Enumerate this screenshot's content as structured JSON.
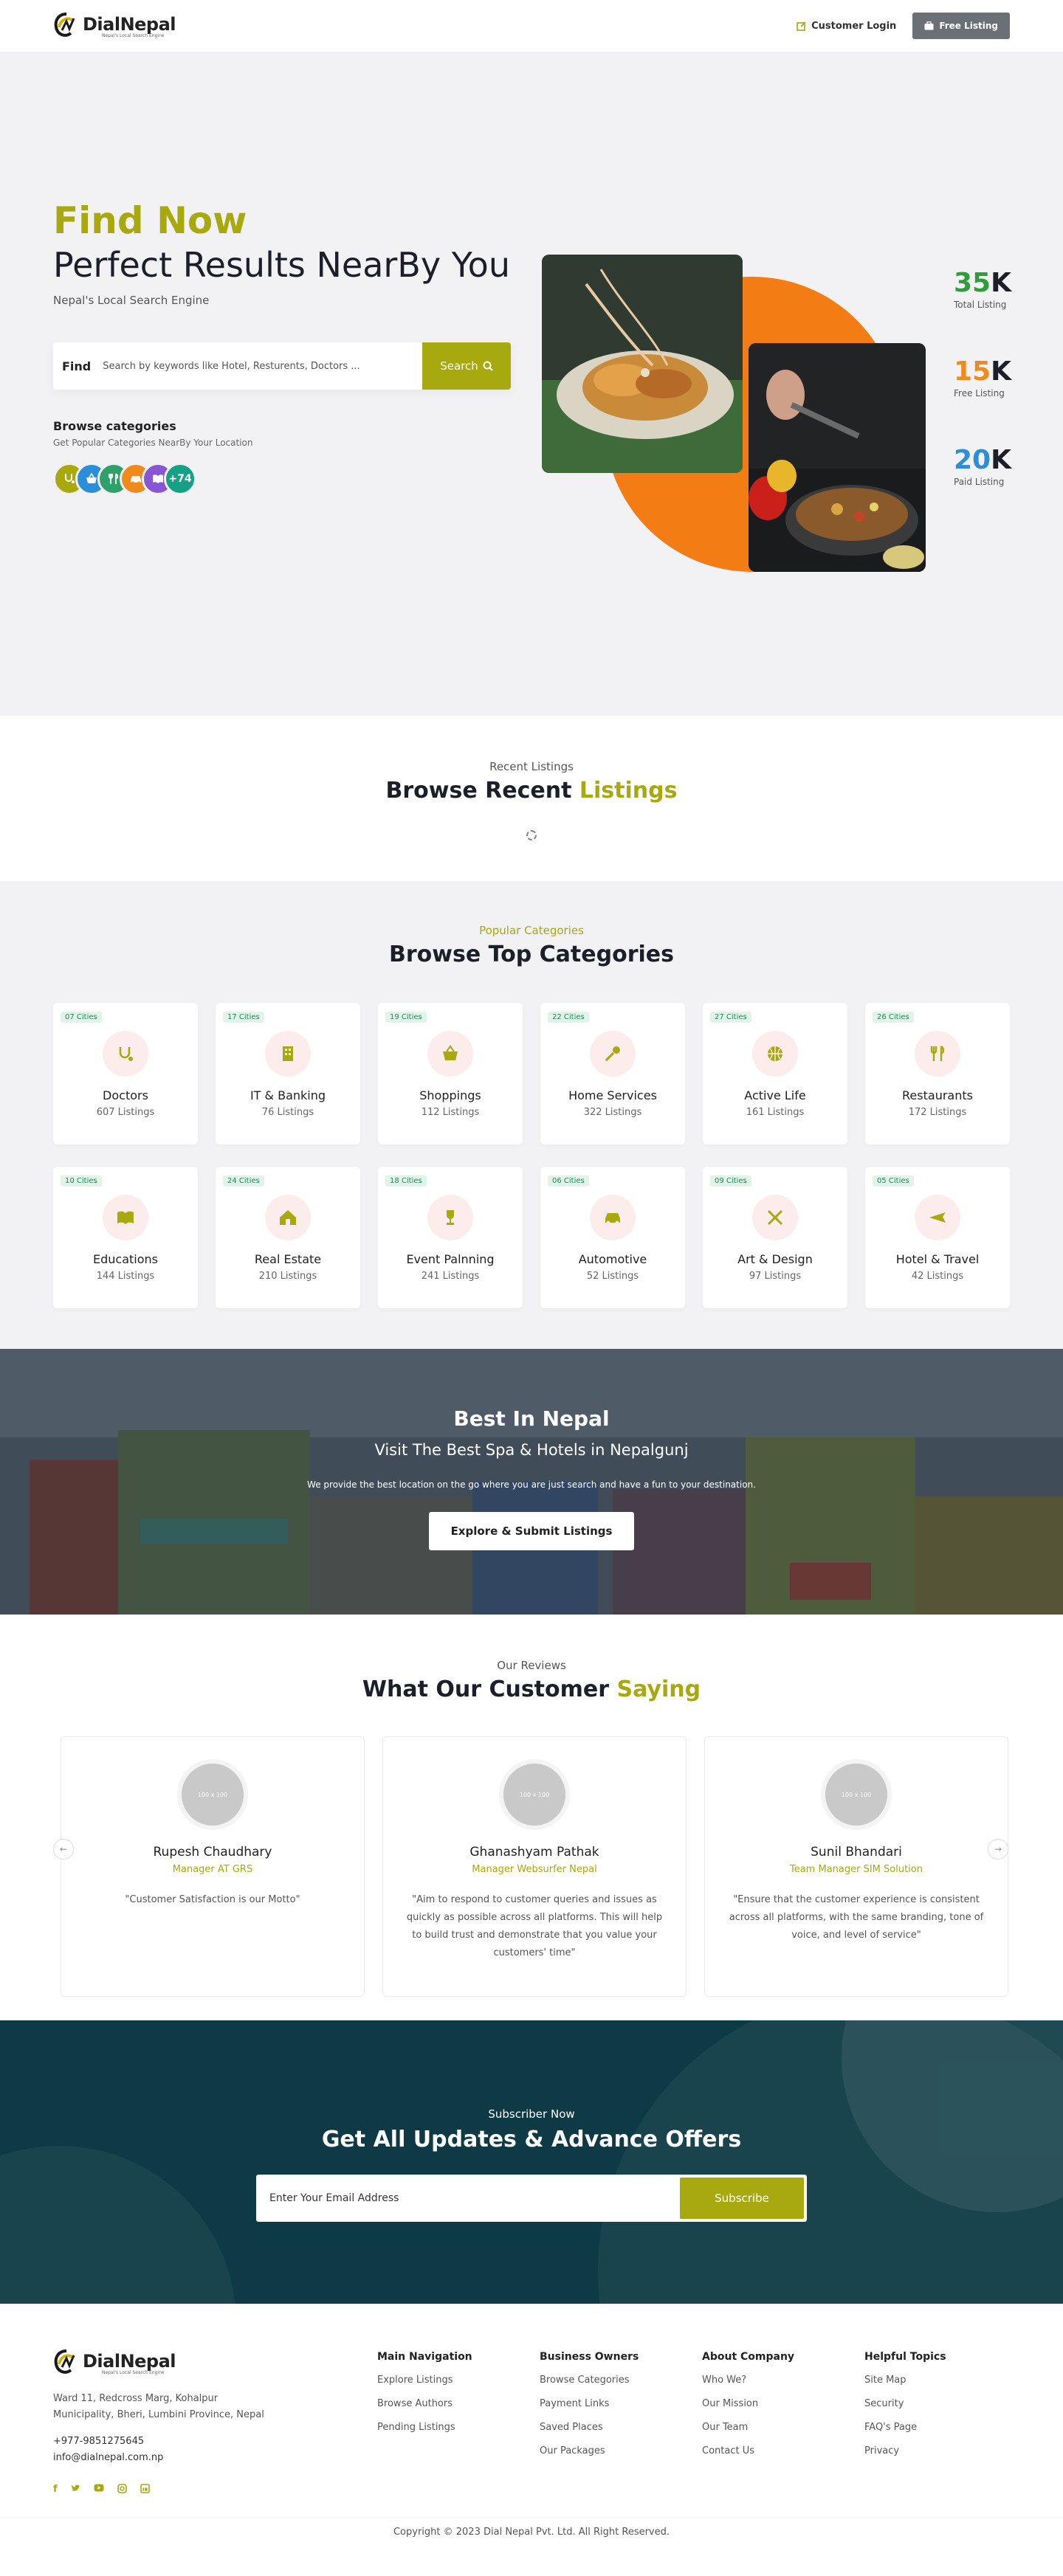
{
  "header": {
    "logo_name": "DialNepal",
    "logo_tagline": "Nepal's Local Search Engine",
    "customer_login": "Customer Login",
    "free_listing": "Free Listing"
  },
  "hero": {
    "title_highlight": "Find Now",
    "title_main": "Perfect Results NearBy You",
    "subtitle": "Nepal's Local Search Engine",
    "search_label": "Find",
    "search_placeholder": "Search by keywords like Hotel, Resturents, Doctors ...",
    "search_button": "Search",
    "browse_title": "Browse categories",
    "browse_sub": "Get Popular Categories NearBy Your Location",
    "more_count": "+74",
    "stats": [
      {
        "value": "35",
        "suffix": "K",
        "label": "Total Listing",
        "color": "#2e9e3a"
      },
      {
        "value": "15",
        "suffix": "K",
        "label": "Free Listing",
        "color": "#f08a1c"
      },
      {
        "value": "20",
        "suffix": "K",
        "label": "Paid Listing",
        "color": "#2a8fd8"
      }
    ]
  },
  "recent": {
    "kicker": "Recent Listings",
    "title_main": "Browse Recent",
    "title_highlight": "Listings"
  },
  "categories": {
    "kicker": "Popular Categories",
    "title": "Browse Top Categories",
    "items": [
      {
        "badge": "07 Cities",
        "name": "Doctors",
        "count": "607 Listings"
      },
      {
        "badge": "17 Cities",
        "name": "IT & Banking",
        "count": "76 Listings"
      },
      {
        "badge": "19 Cities",
        "name": "Shoppings",
        "count": "112 Listings"
      },
      {
        "badge": "22 Cities",
        "name": "Home Services",
        "count": "322 Listings"
      },
      {
        "badge": "27 Cities",
        "name": "Active Life",
        "count": "161 Listings"
      },
      {
        "badge": "26 Cities",
        "name": "Restaurants",
        "count": "172 Listings"
      },
      {
        "badge": "10 Cities",
        "name": "Educations",
        "count": "144 Listings"
      },
      {
        "badge": "24 Cities",
        "name": "Real Estate",
        "count": "210 Listings"
      },
      {
        "badge": "18 Cities",
        "name": "Event Palnning",
        "count": "241 Listings"
      },
      {
        "badge": "06 Cities",
        "name": "Automotive",
        "count": "52 Listings"
      },
      {
        "badge": "09 Cities",
        "name": "Art & Design",
        "count": "97 Listings"
      },
      {
        "badge": "05 Cities",
        "name": "Hotel & Travel",
        "count": "42 Listings"
      }
    ]
  },
  "banner": {
    "title": "Best In Nepal",
    "subtitle": "Visit The Best Spa & Hotels in Nepalgunj",
    "text": "We provide the best location on the go where you are just search and have a fun to your destination.",
    "button": "Explore & Submit Listings"
  },
  "reviews": {
    "kicker": "Our Reviews",
    "title_main": "What Our Customer",
    "title_highlight": "Saying",
    "placeholder": "100 x 100",
    "items": [
      {
        "name": "Rupesh Chaudhary",
        "role": "Manager AT GRS",
        "text": "\"Customer Satisfaction is our Motto\""
      },
      {
        "name": "Ghanashyam Pathak",
        "role": "Manager Websurfer Nepal",
        "text": "\"Aim to respond to customer queries and issues as quickly as possible across all platforms. This will help to build trust and demonstrate that you value your customers' time\""
      },
      {
        "name": "Sunil Bhandari",
        "role": "Team Manager SIM Solution",
        "text": "\"Ensure that the customer experience is consistent across all platforms, with the same branding, tone of voice, and level of service\""
      }
    ]
  },
  "subscribe": {
    "kicker": "Subscriber Now",
    "title": "Get All Updates & Advance Offers",
    "placeholder": "Enter Your Email Address",
    "button": "Subscribe"
  },
  "footer": {
    "address": "Ward 11, Redcross Marg, Kohalpur Municipality, Bheri, Lumbini Province, Nepal",
    "phone": "+977-9851275645",
    "email": "info@dialnepal.com.np",
    "columns": [
      {
        "title": "Main Navigation",
        "links": [
          "Explore Listings",
          "Browse Authors",
          "Pending Listings"
        ]
      },
      {
        "title": "Business Owners",
        "links": [
          "Browse Categories",
          "Payment Links",
          "Saved Places",
          "Our Packages"
        ]
      },
      {
        "title": "About Company",
        "links": [
          "Who We?",
          "Our Mission",
          "Our Team",
          "Contact Us"
        ]
      },
      {
        "title": "Helpful Topics",
        "links": [
          "Site Map",
          "Security",
          "FAQ's Page",
          "Privacy"
        ]
      }
    ],
    "copyright": "Copyright © 2023 Dial Nepal Pvt. Ltd. All Right Reserved."
  },
  "colors": {
    "accent": "#a8a80f",
    "dark_teal": "#0d3a45",
    "orange": "#f47c15"
  }
}
